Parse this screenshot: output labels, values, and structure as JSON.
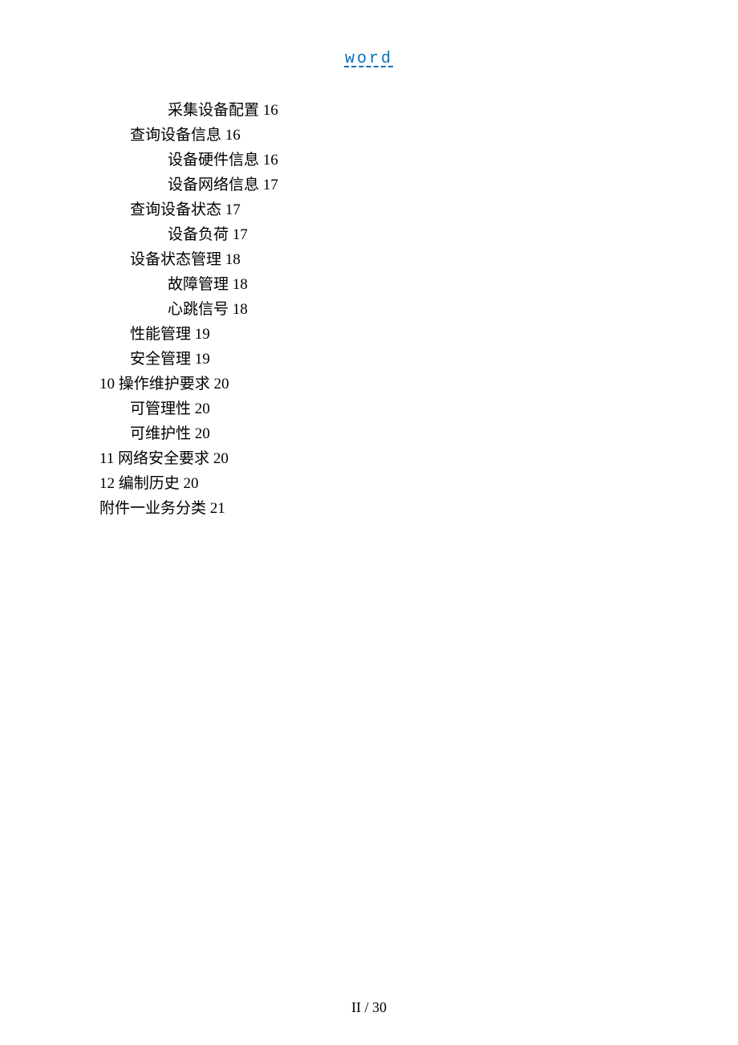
{
  "header_link": "word",
  "toc": [
    {
      "indent": 3,
      "text": "采集设备配置",
      "page": "16"
    },
    {
      "indent": 1,
      "text": "查询设备信息",
      "page": "16"
    },
    {
      "indent": 3,
      "text": "设备硬件信息",
      "page": "16"
    },
    {
      "indent": 3,
      "text": "设备网络信息",
      "page": "17"
    },
    {
      "indent": 1,
      "text": "查询设备状态",
      "page": "17"
    },
    {
      "indent": 3,
      "text": "设备负荷",
      "page": "17"
    },
    {
      "indent": 1,
      "text": "设备状态管理",
      "page": "18"
    },
    {
      "indent": 3,
      "text": "故障管理",
      "page": "18"
    },
    {
      "indent": 3,
      "text": "心跳信号",
      "page": "18"
    },
    {
      "indent": 1,
      "text": "性能管理",
      "page": "19"
    },
    {
      "indent": 1,
      "text": "安全管理",
      "page": "19"
    },
    {
      "indent": 0,
      "prefix": "10",
      "text": "操作维护要求",
      "page": "20"
    },
    {
      "indent": 1,
      "text": "可管理性",
      "page": "20"
    },
    {
      "indent": 1,
      "text": "可维护性",
      "page": "20"
    },
    {
      "indent": 0,
      "prefix": "11",
      "text": "网络安全要求",
      "page": "20"
    },
    {
      "indent": 0,
      "prefix": "12",
      "text": "编制历史",
      "page": "20"
    },
    {
      "indent": 0,
      "text": "附件一业务分类",
      "page": "21"
    }
  ],
  "footer": "II  / 30"
}
